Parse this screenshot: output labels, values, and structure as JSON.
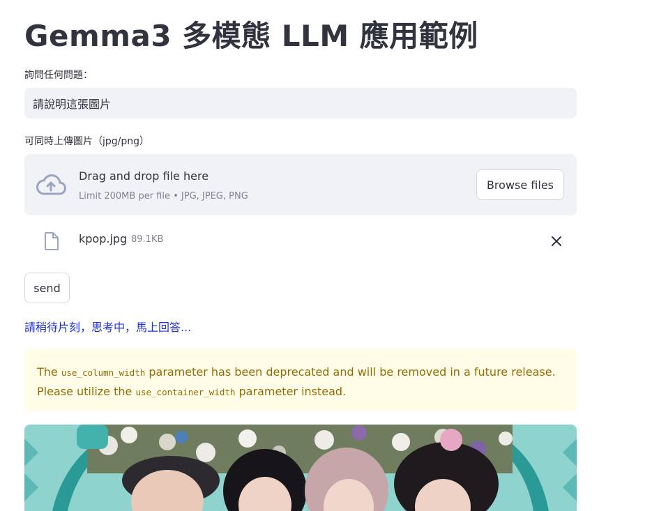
{
  "page": {
    "title": "Gemma3 多模態 LLM 應用範例"
  },
  "question": {
    "label": "詢問任何問題：",
    "value": "請說明這張圖片"
  },
  "upload": {
    "label": "可同時上傳圖片（jpg/png）",
    "drop_text": "Drag and drop file here",
    "limit_text": "Limit 200MB per file • JPG, JPEG, PNG",
    "browse_label": "Browse files",
    "file": {
      "name": "kpop.jpg",
      "size": "89.1KB"
    }
  },
  "send_label": "send",
  "status_text": "請稍待片刻，思考中，馬上回答...",
  "warning": {
    "part1": "The ",
    "code1": "use_column_width",
    "part2": " parameter has been deprecated and will be removed in a future release. Please utilize the ",
    "code2": "use_container_width",
    "part3": " parameter instead."
  },
  "colors": {
    "accent_link": "#1f2fd0",
    "warning_bg": "#fffce7",
    "warning_text": "#926c05",
    "input_bg": "#f0f2f6"
  },
  "icons": [
    "cloud-upload-icon",
    "file-icon",
    "close-icon"
  ]
}
